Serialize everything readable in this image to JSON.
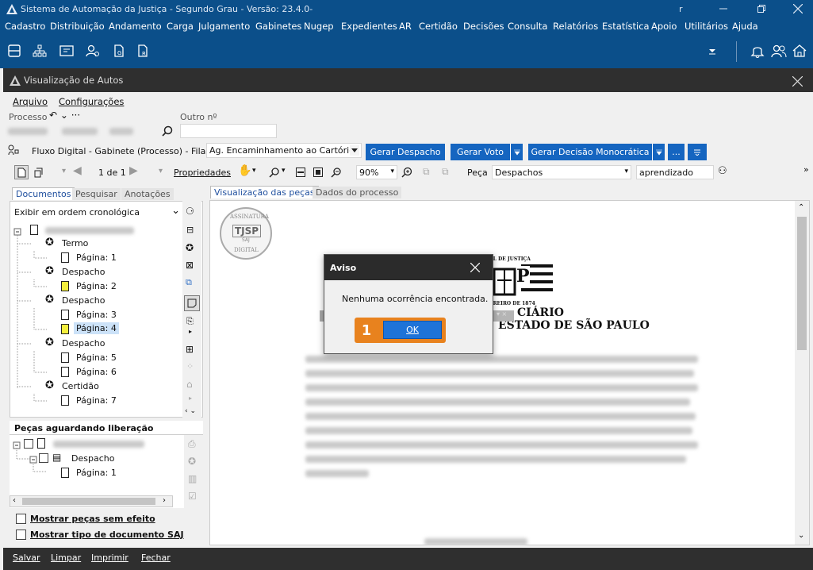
{
  "app_title": "Sistema de Automação da Justiça - Segundo Grau - Versão: 23.4.0-",
  "title_extra": "r",
  "menu": [
    "Cadastro",
    "Distribuição",
    "Andamento",
    "Carga",
    "Julgamento",
    "Gabinetes",
    "Nugep",
    "Expedientes",
    "AR",
    "Certidão",
    "Decisões",
    "Consulta",
    "Relatórios",
    "Estatística",
    "Apoio",
    "Utilitários",
    "Ajuda"
  ],
  "window_title": "Visualização de Autos",
  "win_menu": {
    "arquivo": "Arquivo",
    "config": "Configurações"
  },
  "processo_label": "Processo",
  "outro_label": "Outro nº",
  "fluxo_label": "Fluxo Digital - Gabinete (Processo) - Fila:",
  "fila_value": "Ag. Encaminhamento ao Cartório",
  "buttons": {
    "gerar_despacho": "Gerar Despacho",
    "gerar_voto": "Gerar Voto",
    "gerar_decisao": "Gerar Decisão Monocrática",
    "more": "..."
  },
  "viewer": {
    "page": "1 de 1",
    "props": "Propriedades",
    "zoom": "90%",
    "peca_label": "Peça",
    "peca_value": "Despachos",
    "search_value": "aprendizado"
  },
  "left_tabs": [
    "Documentos",
    "Pesquisar",
    "Anotações"
  ],
  "order_value": "Exibir em ordem cronológica",
  "tree": [
    {
      "label": "Termo"
    },
    {
      "label": "Página: 1"
    },
    {
      "label": "Despacho"
    },
    {
      "label": "Página: 2"
    },
    {
      "label": "Despacho"
    },
    {
      "label": "Página: 3"
    },
    {
      "label": "Página: 4"
    },
    {
      "label": "Despacho"
    },
    {
      "label": "Página: 5"
    },
    {
      "label": "Página: 6"
    },
    {
      "label": "Certidão"
    },
    {
      "label": "Página: 7"
    }
  ],
  "pending_title": "Peças aguardando liberação",
  "pending": [
    {
      "label": "Despacho"
    },
    {
      "label": "Página: 1"
    }
  ],
  "opt1": "Mostrar peças sem efeito",
  "opt2": "Mostrar tipo de documento SAJ",
  "right_tabs": [
    "Visualização das peças",
    "Dados do processo"
  ],
  "doc": {
    "seal_top": "ASSINATURA",
    "seal_mid": "TJSP",
    "seal_sub": "SAJ",
    "seal_bottom": "DIGITAL",
    "head1": "CIÁRIO",
    "head2": "ESTADO DE SÃO PAULO",
    "small1": "AL DE JUSTIÇA",
    "small2": "EREIRO DE 1874",
    "letter": "P"
  },
  "dialog": {
    "title": "Aviso",
    "message": "Nenhuma ocorrência encontrada.",
    "ok": "OK",
    "step": "1"
  },
  "bottom": [
    "Salvar",
    "Limpar",
    "Imprimir",
    "Fechar"
  ],
  "colors": {
    "blue": "#0b4f8a",
    "button": "#1565c0",
    "orange": "#e8821e"
  }
}
